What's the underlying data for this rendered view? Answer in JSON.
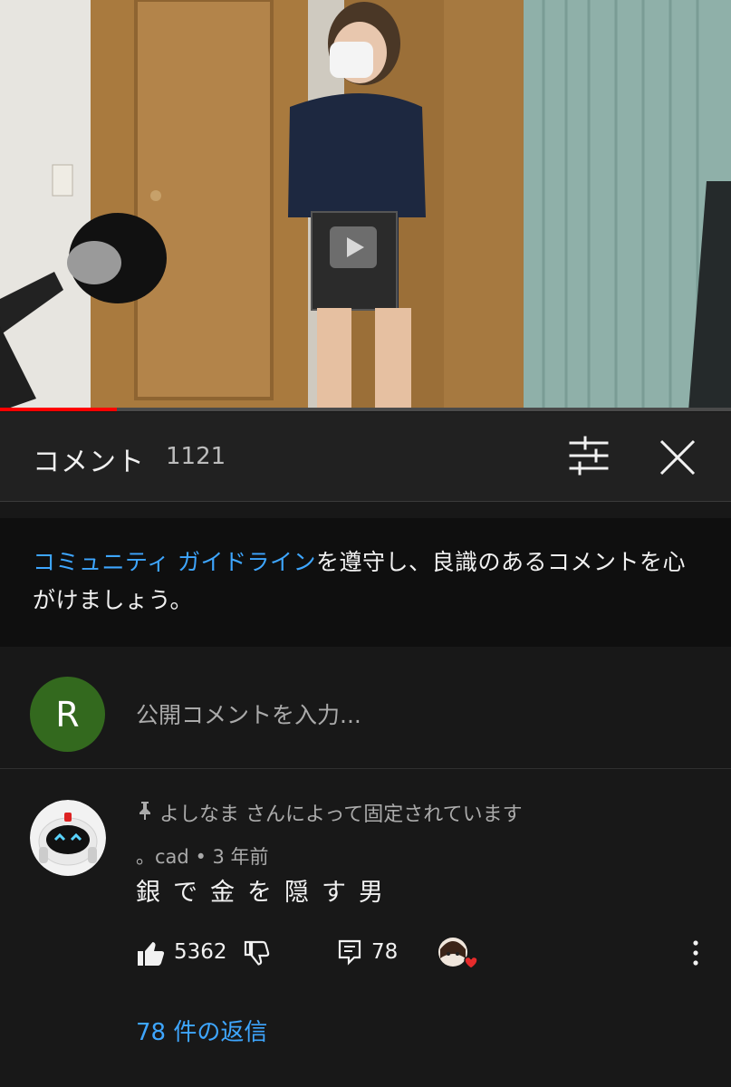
{
  "video": {
    "progress_fraction": 0.16
  },
  "comments_panel": {
    "title": "コメント",
    "count": "1121",
    "filter_icon": "sliders-icon",
    "close_icon": "close-icon"
  },
  "guideline": {
    "link_text": "コミュニティ ガイドライン",
    "rest_text": "を遵守し、良識のあるコメントを心がけましょう。"
  },
  "composer": {
    "avatar_letter": "R",
    "avatar_color": "#33691e",
    "placeholder": "公開コメントを入力..."
  },
  "comment": {
    "pinned_label": "よしなま さんによって固定されています",
    "author": "。cad",
    "separator": "•",
    "time": "3 年前",
    "text": "銀で金を隠す男",
    "like_count": "5362",
    "reply_count": "78",
    "replies_link": "78 件の返信"
  },
  "colors": {
    "link": "#3ea6ff",
    "progress": "#ff0000",
    "background": "#181818",
    "header": "#212121"
  }
}
